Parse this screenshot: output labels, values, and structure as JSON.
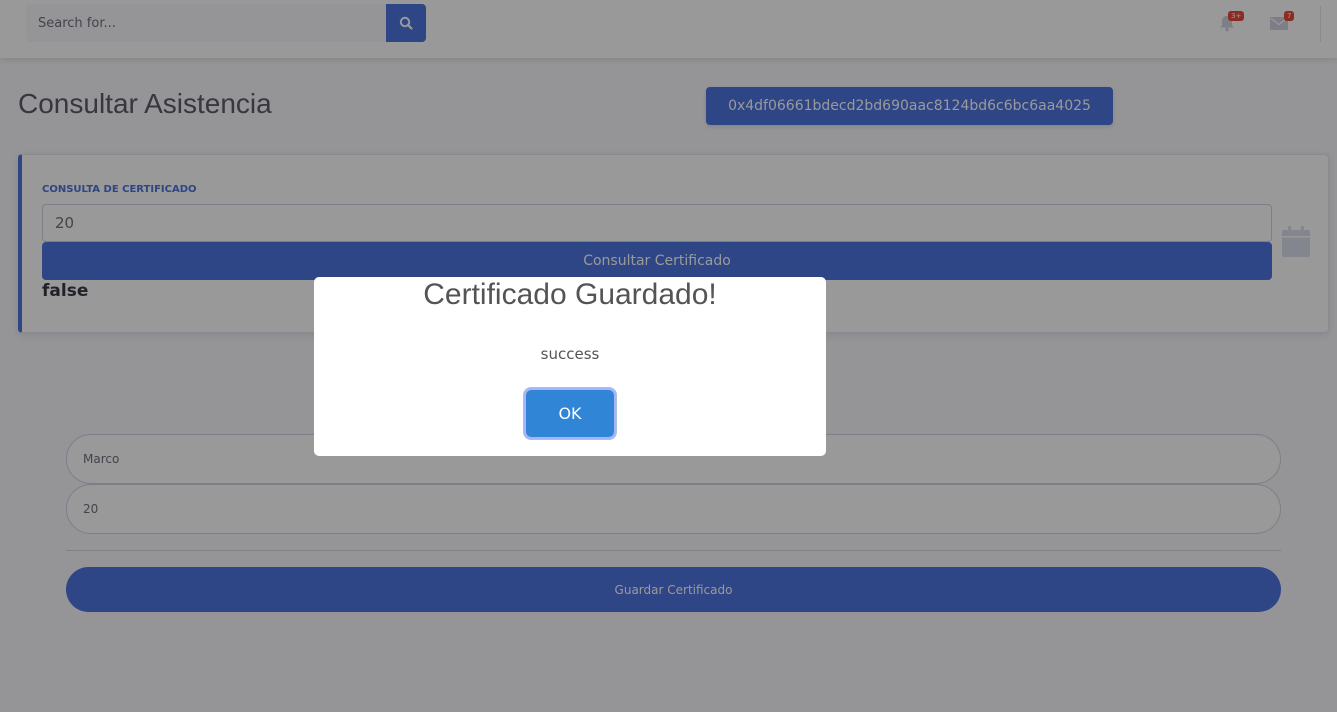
{
  "topbar": {
    "search_placeholder": "Search for...",
    "notifications_badge": "3+",
    "messages_badge": "7"
  },
  "page": {
    "title": "Consultar Asistencia",
    "account_hash": "0x4df06661bdecd2bd690aac8124bd6c6bc6aa4025"
  },
  "card": {
    "label": "CONSULTA DE CERTIFICADO",
    "input_value": "20",
    "consult_button": "Consultar Certificado",
    "result": "false"
  },
  "form": {
    "name_value": "Marco",
    "id_value": "20",
    "save_button": "Guardar Certificado"
  },
  "modal": {
    "title": "Certificado Guardado!",
    "text": "success",
    "ok_button": "OK"
  },
  "colors": {
    "primary": "#4e73df",
    "modal_ok": "#3085d6",
    "badge": "#e74a3b"
  }
}
